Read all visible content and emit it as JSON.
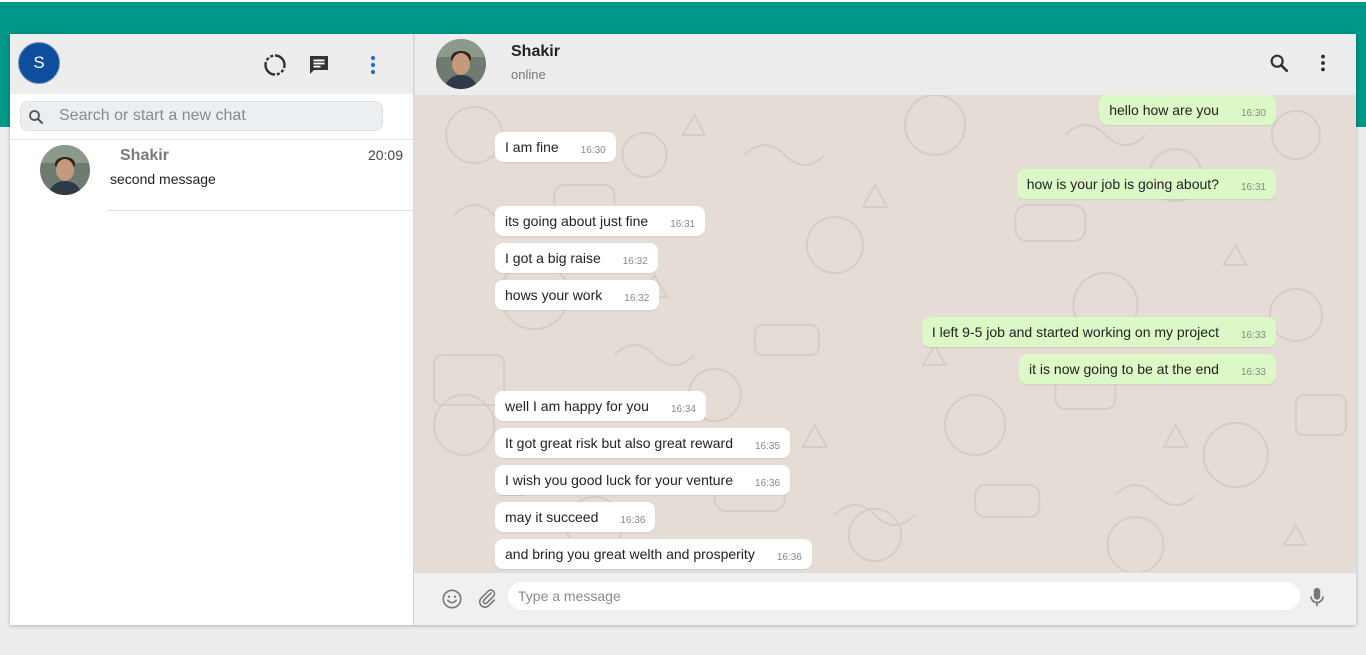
{
  "colors": {
    "accent_band": "#009688",
    "profile_avatar": "#0d4f9c",
    "incoming_bubble": "#ffffff",
    "outgoing_bubble": "#dcf8c6",
    "chat_background": "#e5ddd5"
  },
  "sidebar": {
    "profile_initial": "S",
    "icons": [
      "status-icon",
      "new-chat-icon",
      "menu-icon"
    ],
    "search": {
      "placeholder": "Search or start a new chat",
      "value": ""
    },
    "chats": [
      {
        "name": "Shakir",
        "last_message": "second message",
        "time": "20:09"
      }
    ]
  },
  "conversation": {
    "contact_name": "Shakir",
    "contact_status": "online",
    "messages": [
      {
        "dir": "out",
        "text": "hello how are you",
        "time": "16:30"
      },
      {
        "dir": "in",
        "text": "I am fine",
        "time": "16:30"
      },
      {
        "dir": "out",
        "text": "how is your job is going about?",
        "time": "16:31"
      },
      {
        "dir": "in",
        "text": "its going about just fine",
        "time": "16:31"
      },
      {
        "dir": "in",
        "text": "I got a big raise",
        "time": "16:32"
      },
      {
        "dir": "in",
        "text": "hows your work",
        "time": "16:32"
      },
      {
        "dir": "out",
        "text": "I left 9-5 job and started working on my project",
        "time": "16:33"
      },
      {
        "dir": "out",
        "text": "it is now going to be at the end",
        "time": "16:33"
      },
      {
        "dir": "in",
        "text": "well I am happy for you",
        "time": "16:34"
      },
      {
        "dir": "in",
        "text": "It got great risk but also great reward",
        "time": "16:35"
      },
      {
        "dir": "in",
        "text": "I wish you good luck for your venture",
        "time": "16:36"
      },
      {
        "dir": "in",
        "text": "may it succeed",
        "time": "16:36"
      },
      {
        "dir": "in",
        "text": "and bring you great welth and prosperity",
        "time": "16:36"
      }
    ]
  },
  "composer": {
    "placeholder": "Type a message",
    "value": ""
  }
}
